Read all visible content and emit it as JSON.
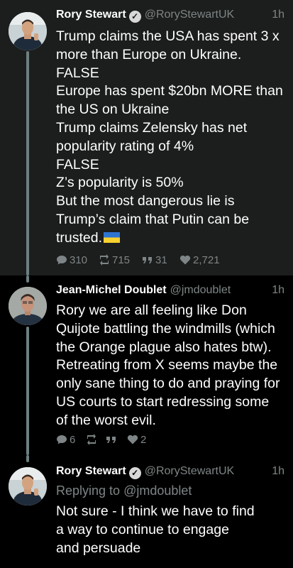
{
  "tweets": [
    {
      "author": "Rory Stewart",
      "handle": "@RoryStewartUK",
      "time": "1h",
      "lines": [
        "Trump claims the USA has spent 3 x",
        "more than Europe on Ukraine.",
        "FALSE",
        "Europe has spent $20bn MORE than",
        "the US on Ukraine",
        "Trump claims Zelensky has net",
        "popularity rating of 4%",
        "FALSE",
        "Z’s popularity is 50%",
        "But the most dangerous lie is",
        "Trump’s claim that Putin can be",
        "trusted."
      ],
      "emoji": "ukraine-flag",
      "replies": "310",
      "retweets": "715",
      "quotes": "31",
      "likes": "2,721"
    },
    {
      "author": "Jean-Michel Doublet",
      "handle": "@jmdoublet",
      "time": "1h",
      "lines": [
        "Rory we are all feeling like Don",
        "Quijote battling the windmills (which",
        "the Orange plague also hates btw).",
        "Retreating from X seems maybe the",
        "only sane thing to do and praying for",
        "US courts to start redressing some",
        "of the worst evil."
      ],
      "replies": "6",
      "retweets": "",
      "quotes": "",
      "likes": "2"
    },
    {
      "author": "Rory Stewart",
      "handle": "@RoryStewartUK",
      "time": "1h",
      "reply_prefix": "Replying to",
      "reply_handle": "@jmdoublet",
      "lines": [
        "Not sure - I think we have to find",
        "a way to continue to engage",
        "and persuade"
      ]
    }
  ],
  "colors": {
    "muted": "#7e8586",
    "thread_line": "#6d7f80",
    "focus_bg": "#1c1d1d",
    "bg": "#000000"
  }
}
